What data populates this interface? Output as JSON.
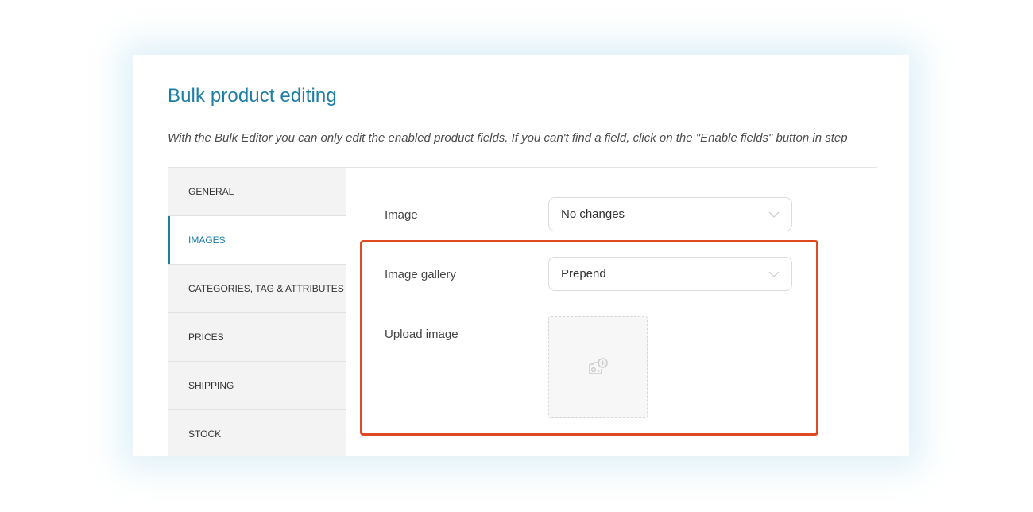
{
  "header": {
    "title": "Bulk product editing",
    "intro": "With the Bulk Editor you can only edit the enabled product fields. If you can't find a field, click on the \"Enable fields\" button in step"
  },
  "tabs": [
    {
      "label": "GENERAL",
      "active": false
    },
    {
      "label": "IMAGES",
      "active": true
    },
    {
      "label": "CATEGORIES, TAG & ATTRIBUTES",
      "active": false
    },
    {
      "label": "PRICES",
      "active": false
    },
    {
      "label": "SHIPPING",
      "active": false
    },
    {
      "label": "STOCK",
      "active": false
    }
  ],
  "fields": {
    "image": {
      "label": "Image",
      "value": "No changes"
    },
    "image_gallery": {
      "label": "Image gallery",
      "value": "Prepend"
    },
    "upload_image": {
      "label": "Upload image",
      "icon": "add-photo-icon"
    }
  },
  "colors": {
    "accent": "#1d7ea6",
    "highlight": "#e04a23",
    "tab_bg": "#f3f3f3"
  }
}
